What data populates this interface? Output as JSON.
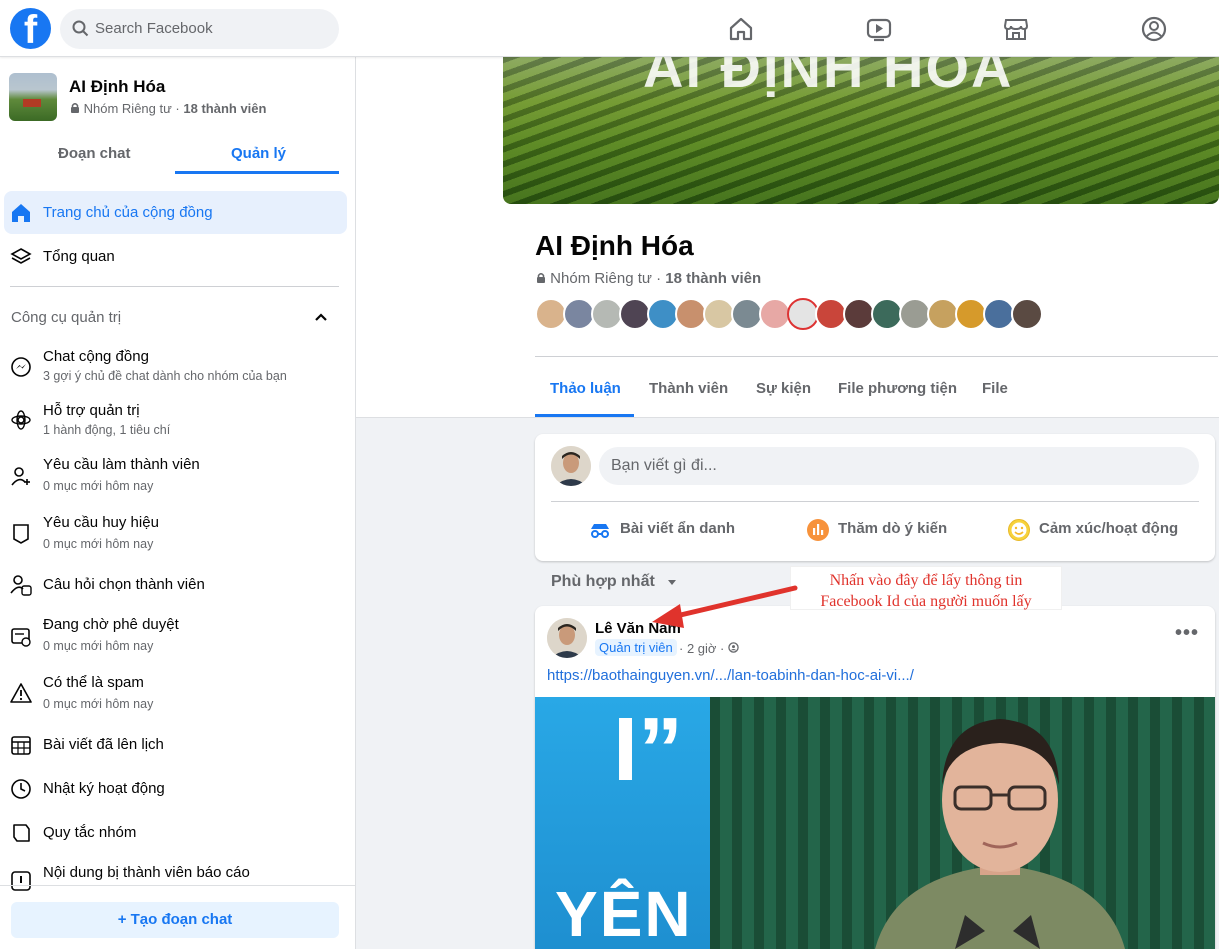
{
  "topbar": {
    "logo_letter": "f",
    "search_placeholder": "Search Facebook",
    "nav_icons": [
      "home-icon",
      "video-icon",
      "marketplace-icon",
      "groups-icon"
    ]
  },
  "sidebar": {
    "group_name": "AI Định Hóa",
    "group_privacy": "Nhóm Riêng tư",
    "group_members": "18 thành viên",
    "tabs": [
      {
        "label": "Đoạn chat"
      },
      {
        "label": "Quản lý"
      }
    ],
    "items": [
      {
        "label": "Trang chủ của cộng đồng",
        "icon": "home-icon"
      },
      {
        "label": "Tổng quan",
        "icon": "layers-icon"
      }
    ],
    "section_title": "Công cụ quản trị",
    "admin_tools": [
      {
        "label": "Chat cộng đồng",
        "sub": "3 gợi ý chủ đề chat dành cho nhóm của bạn",
        "icon": "messenger-icon"
      },
      {
        "label": "Hỗ trợ quản trị",
        "sub": "1 hành động, 1 tiêu chí",
        "icon": "admin-assist-icon"
      },
      {
        "label": "Yêu cầu làm thành viên",
        "sub": "0 mục mới hôm nay",
        "icon": "member-request-icon"
      },
      {
        "label": "Yêu cầu huy hiệu",
        "sub": "0 mục mới hôm nay",
        "icon": "badge-icon"
      },
      {
        "label": "Câu hỏi chọn thành viên",
        "sub": "",
        "icon": "member-question-icon"
      },
      {
        "label": "Đang chờ phê duyệt",
        "sub": "0 mục mới hôm nay",
        "icon": "pending-icon"
      },
      {
        "label": "Có thể là spam",
        "sub": "0 mục mới hôm nay",
        "icon": "warning-icon"
      },
      {
        "label": "Bài viết đã lên lịch",
        "sub": "",
        "icon": "calendar-icon"
      },
      {
        "label": "Nhật ký hoạt động",
        "sub": "",
        "icon": "clock-icon"
      },
      {
        "label": "Quy tắc nhóm",
        "sub": "",
        "icon": "rules-icon"
      },
      {
        "label": "Nội dung bị thành viên báo cáo",
        "sub": "",
        "icon": "report-icon"
      }
    ],
    "create_chat": "Tạo đoạn chat"
  },
  "main": {
    "cover_text": "AI ĐỊNH HÓA",
    "title": "AI Định Hóa",
    "privacy": "Nhóm Riêng tư",
    "members": "18 thành viên",
    "tabs": [
      {
        "label": "Thảo luận"
      },
      {
        "label": "Thành viên"
      },
      {
        "label": "Sự kiện"
      },
      {
        "label": "File phương tiện"
      },
      {
        "label": "File"
      }
    ],
    "composer": {
      "placeholder": "Bạn viết gì đi...",
      "actions": [
        {
          "label": "Bài viết ẩn danh",
          "icon": "anonymous-icon"
        },
        {
          "label": "Thăm dò ý kiến",
          "icon": "poll-icon"
        },
        {
          "label": "Cảm xúc/hoạt động",
          "icon": "smile-icon"
        }
      ]
    },
    "sort_label": "Phù hợp nhất",
    "post": {
      "author": "Lê Văn Nam",
      "badge": "Quản trị viên",
      "time": "· 2 giờ ·",
      "link": "https://baothainguyen.vn/.../lan-toabinh-dan-hoc-ai-vi.../",
      "image_text": "YÊN",
      "image_quote": "I”"
    }
  },
  "annotation": {
    "line1": "Nhấn vào đây để lấy thông tin",
    "line2": "Facebook Id của người muốn lấy",
    "color": "#e0332c"
  }
}
